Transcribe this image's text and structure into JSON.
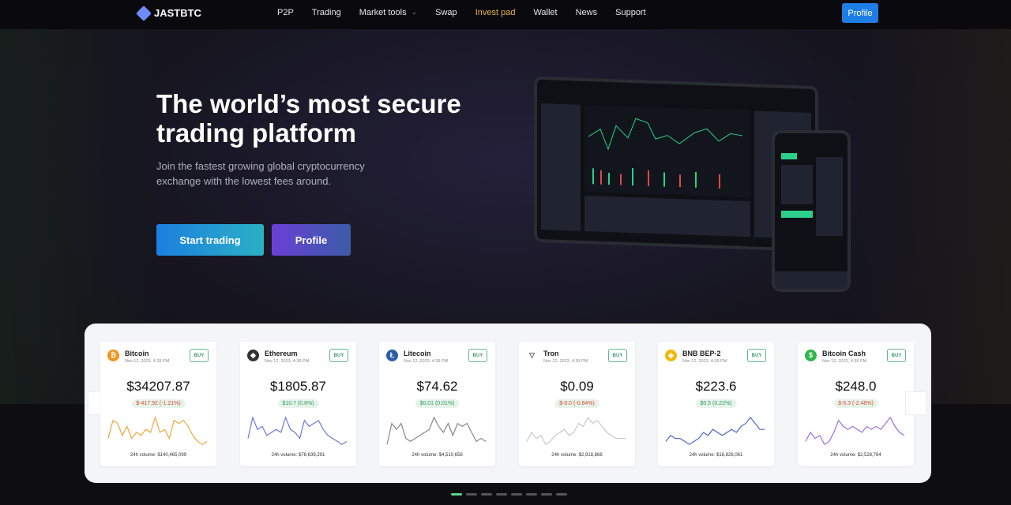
{
  "nav": {
    "brand": "JASTBTC",
    "items": [
      "P2P",
      "Trading",
      "Market tools",
      "Swap",
      "Invest pad",
      "Wallet",
      "News",
      "Support"
    ],
    "active": "Invest pad",
    "profile": "Profile"
  },
  "hero": {
    "title": "The world’s most secure trading platform",
    "subtitle": "Join the fastest growing global cryptocurrency exchange with the lowest fees around.",
    "start": "Start trading",
    "profile": "Profile"
  },
  "buy_label": "BUY",
  "volume_label": "24h volume:",
  "coins": [
    {
      "name": "Bitcoin",
      "date": "Nov 12, 2023, 4:39 PM",
      "price": "$34207.87",
      "change": "$-417.92 (-1.21%)",
      "dir": "neg",
      "volume": "$140,465,099",
      "color": "#f0a53a",
      "icon": "bitcoin-icon",
      "glyph": "₿",
      "iconbg": "#f0931a",
      "spark": [
        3,
        9,
        8,
        4,
        7,
        3,
        5,
        4,
        6,
        5,
        10,
        5,
        6,
        3,
        9,
        8,
        9,
        7,
        4,
        2,
        1,
        2
      ]
    },
    {
      "name": "Ethereum",
      "date": "Nov 12, 2023, 4:39 PM",
      "price": "$1805.87",
      "change": "$10.7 (0.6%)",
      "dir": "pos",
      "volume": "$78,639,291",
      "color": "#6b78d8",
      "icon": "ethereum-icon",
      "glyph": "◆",
      "iconbg": "#333",
      "spark": [
        3,
        10,
        6,
        7,
        4,
        5,
        6,
        5,
        10,
        6,
        5,
        3,
        9,
        7,
        8,
        9,
        6,
        4,
        3,
        2,
        1,
        2
      ]
    },
    {
      "name": "Litecoin",
      "date": "Nov 12, 2023, 4:39 PM",
      "price": "$74.62",
      "change": "$0.01 (0.01%)",
      "dir": "pos",
      "volume": "$4,510,658",
      "color": "#888888",
      "icon": "litecoin-icon",
      "glyph": "Ł",
      "iconbg": "#2c5ea8",
      "spark": [
        1,
        8,
        6,
        8,
        3,
        2,
        3,
        4,
        5,
        6,
        10,
        7,
        5,
        8,
        4,
        8,
        7,
        8,
        5,
        2,
        3,
        2
      ]
    },
    {
      "name": "Tron",
      "date": "Nov 12, 2023, 4:39 PM",
      "price": "$0.09",
      "change": "$-0.0 (-0.84%)",
      "dir": "neg",
      "volume": "$2,918,868",
      "color": "#c8c8c8",
      "icon": "tron-icon",
      "glyph": "▽",
      "iconbg": "#ffffff",
      "spark": [
        2,
        5,
        3,
        4,
        1,
        2,
        4,
        5,
        6,
        4,
        5,
        8,
        7,
        10,
        8,
        9,
        7,
        5,
        4,
        3,
        3,
        3
      ]
    },
    {
      "name": "BNB BEP-2",
      "date": "Nov 12, 2023, 4:39 PM",
      "price": "$223.6",
      "change": "$0.5 (0.22%)",
      "dir": "pos",
      "volume": "$16,826,061",
      "color": "#4a68c8",
      "icon": "bnb-icon",
      "glyph": "◈",
      "iconbg": "#f0b90b",
      "spark": [
        2,
        4,
        3,
        3,
        2,
        1,
        2,
        3,
        5,
        4,
        6,
        5,
        4,
        5,
        6,
        5,
        7,
        8,
        10,
        8,
        6,
        6
      ]
    },
    {
      "name": "Bitcoin Cash",
      "date": "Nov 12, 2023, 4:39 PM",
      "price": "$248.0",
      "change": "$-6.3 (-2.48%)",
      "dir": "neg",
      "volume": "$2,528,784",
      "color": "#9a6ee0",
      "icon": "bitcoin-cash-icon",
      "glyph": "$",
      "iconbg": "#2fb54a",
      "spark": [
        2,
        5,
        3,
        4,
        1,
        2,
        5,
        9,
        7,
        6,
        7,
        6,
        5,
        7,
        6,
        7,
        6,
        8,
        10,
        7,
        5,
        4
      ]
    }
  ],
  "pagination": {
    "count": 8,
    "active": 0
  }
}
